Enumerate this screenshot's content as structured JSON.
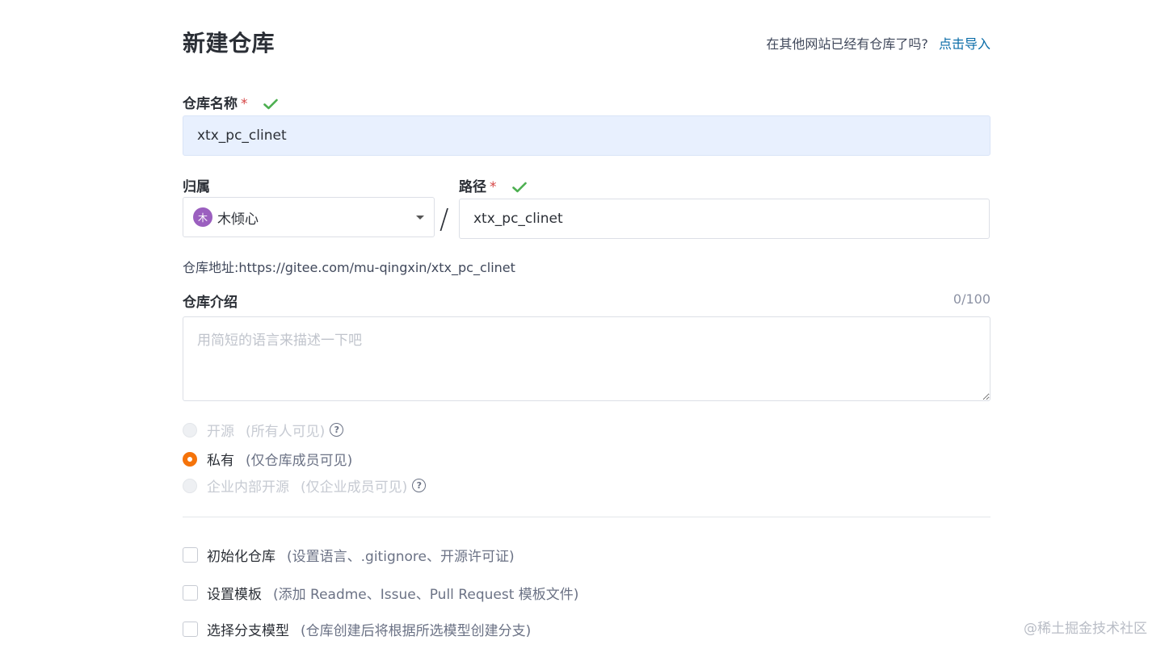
{
  "header": {
    "title": "新建仓库",
    "import_question": "在其他网站已经有仓库了吗?",
    "import_link": "点击导入"
  },
  "repo_name": {
    "label": "仓库名称",
    "required_mark": "*",
    "value": "xtx_pc_clinet"
  },
  "owner": {
    "label": "归属",
    "avatar_text": "木",
    "name": "木倾心"
  },
  "path": {
    "label": "路径",
    "required_mark": "*",
    "separator": "/",
    "value": "xtx_pc_clinet"
  },
  "address": {
    "text": "仓库地址:https://gitee.com/mu-qingxin/xtx_pc_clinet"
  },
  "intro": {
    "label": "仓库介绍",
    "counter": "0/100",
    "placeholder": "用简短的语言来描述一下吧"
  },
  "visibility": {
    "options": [
      {
        "label": "开源",
        "desc": "(所有人可见)",
        "state": "disabled",
        "help_icon": "?"
      },
      {
        "label": "私有",
        "desc": "(仅仓库成员可见)",
        "state": "checked"
      },
      {
        "label": "企业内部开源",
        "desc": "(仅企业成员可见)",
        "state": "disabled",
        "help_icon": "?"
      }
    ]
  },
  "options": {
    "items": [
      {
        "label": "初始化仓库",
        "desc": "(设置语言、.gitignore、开源许可证)",
        "checked": false
      },
      {
        "label": "设置模板",
        "desc": "(添加 Readme、Issue、Pull Request 模板文件)",
        "checked": false
      },
      {
        "label": "选择分支模型",
        "desc": "(仓库创建后将根据所选模型创建分支)",
        "checked": false
      }
    ]
  },
  "watermark": "@稀土掘金技术社区",
  "colors": {
    "accent": "#f5730a",
    "link": "#0a6ca8",
    "check": "#4caf50",
    "required": "#d64545",
    "avatar": "#9b5fbf"
  }
}
